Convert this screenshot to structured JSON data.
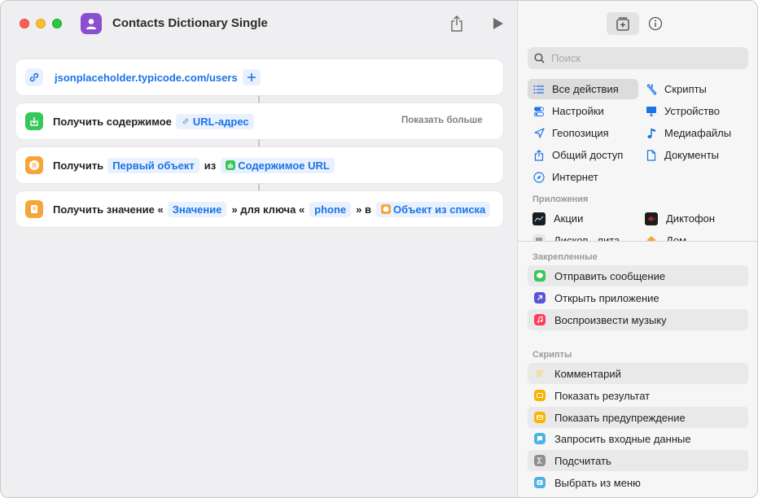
{
  "window": {
    "title": "Contacts Dictionary Single"
  },
  "actions": [
    {
      "id": "url",
      "url": "jsonplaceholder.typicode.com/users"
    },
    {
      "id": "get-contents",
      "label": "Получить содержимое",
      "param": "URL-адрес",
      "show_more": "Показать больше"
    },
    {
      "id": "get-item",
      "label": "Получить",
      "param": "Первый объект",
      "from": "из",
      "source": "Содержимое URL"
    },
    {
      "id": "get-value",
      "label": "Получить значение «",
      "param": "Значение",
      "mid": "» для ключа «",
      "key": "phone",
      "in": "» в",
      "source": "Объект из списка"
    }
  ],
  "sidebar": {
    "search_placeholder": "Поиск",
    "categories_left": [
      {
        "label": "Все действия",
        "icon": "list-icon",
        "selected": true
      },
      {
        "label": "Настройки",
        "icon": "toggle-icon"
      },
      {
        "label": "Геопозиция",
        "icon": "location-arrow-icon"
      },
      {
        "label": "Общий доступ",
        "icon": "share-icon"
      },
      {
        "label": "Интернет",
        "icon": "compass-icon"
      }
    ],
    "categories_right": [
      {
        "label": "Скрипты",
        "icon": "scroll-icon"
      },
      {
        "label": "Устройство",
        "icon": "monitor-icon"
      },
      {
        "label": "Медиафайлы",
        "icon": "music-note-icon"
      },
      {
        "label": "Документы",
        "icon": "document-icon"
      }
    ],
    "apps_header": "Приложения",
    "apps": [
      {
        "label": "Акции",
        "icon": "stocks-icon"
      },
      {
        "label": "Диктофон",
        "icon": "voice-memos-icon"
      },
      {
        "label": "Дисков...лита",
        "icon": "disk-utility-icon"
      },
      {
        "label": "Дом",
        "icon": "home-icon"
      }
    ],
    "pinned_header": "Закрепленные",
    "pinned": [
      {
        "label": "Отправить сообщение",
        "icon": "messages-icon",
        "color": "#34c759"
      },
      {
        "label": "Открыть приложение",
        "icon": "open-app-icon",
        "color": "#5856d6"
      },
      {
        "label": "Воспроизвести музыку",
        "icon": "music-icon",
        "color": "#ff3b5c"
      }
    ],
    "scripts_header": "Скрипты",
    "scripts": [
      {
        "label": "Комментарий",
        "icon": "comment-icon",
        "color": "#f7d154"
      },
      {
        "label": "Показать результат",
        "icon": "show-result-icon",
        "color": "#f7b500"
      },
      {
        "label": "Показать предупреждение",
        "icon": "alert-icon",
        "color": "#f7b500"
      },
      {
        "label": "Запросить входные данные",
        "icon": "ask-input-icon",
        "color": "#4fb3e8"
      },
      {
        "label": "Подсчитать",
        "icon": "sigma-icon",
        "color": "#8e8e93"
      },
      {
        "label": "Выбрать из меню",
        "icon": "menu-icon",
        "color": "#4fb3e8"
      }
    ]
  }
}
